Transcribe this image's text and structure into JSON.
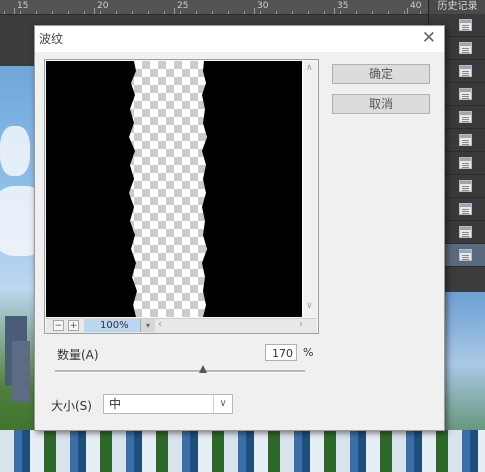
{
  "ruler": {
    "numbers": [
      "15",
      "20",
      "25",
      "30",
      "35",
      "40"
    ]
  },
  "history_panel": {
    "title": "历史记录",
    "row_count": 11,
    "selected_row": 10
  },
  "dialog": {
    "title": "波纹",
    "close_label": "✕",
    "ok_label": "确定",
    "cancel_label": "取消",
    "zoom": {
      "minus": "−",
      "plus": "+",
      "value": "100%",
      "dropdown": "▾"
    },
    "amount": {
      "label": "数量(A)",
      "value": "170",
      "unit": "%",
      "slider_fraction": 0.59
    },
    "size": {
      "label": "大小(S)",
      "value": "中",
      "chevron": "∨"
    }
  }
}
